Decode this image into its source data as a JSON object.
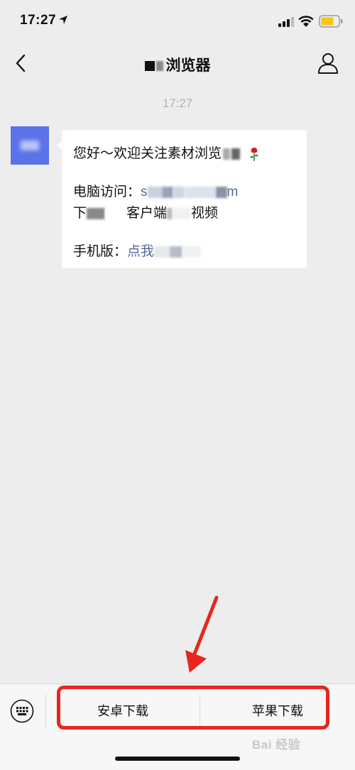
{
  "status_bar": {
    "time": "17:27",
    "battery_color": "#f5c518"
  },
  "nav": {
    "title": "浏览器"
  },
  "chat": {
    "timestamp": "17:27",
    "message": {
      "line1": "您好～欢迎关注素材浏览",
      "line2_label": "电脑访问：",
      "line2_link_start": "s",
      "line2_link_end": "m",
      "line3_a": "下",
      "line3_b": "客户端",
      "line3_c": "视频",
      "line4_label": "手机版：",
      "line4_link": "点我"
    }
  },
  "bottom_menu": {
    "left_label": "安卓下载",
    "right_label": "苹果下载"
  },
  "watermark": "Bai 经验",
  "colors": {
    "background": "#ededed",
    "link": "#576b95",
    "annotation": "#e8261f",
    "avatar": "#5b73e8"
  }
}
